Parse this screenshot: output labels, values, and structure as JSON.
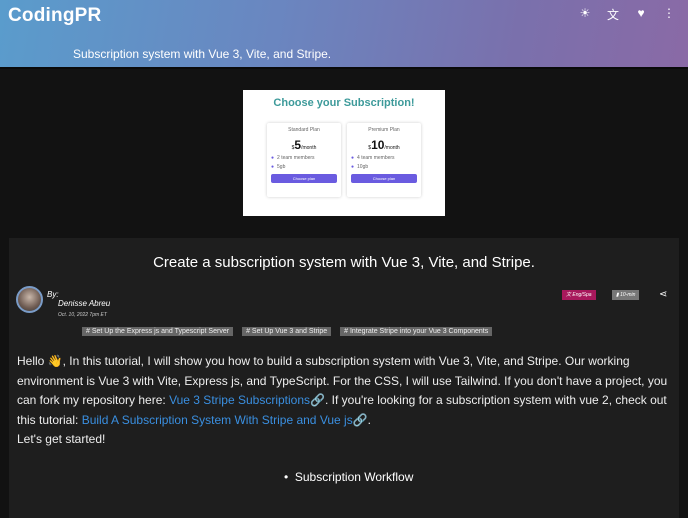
{
  "header": {
    "brand": "CodingPR",
    "subtitle": "Subscription system with Vue 3, Vite, and Stripe.",
    "icons": [
      "brightness-icon",
      "translate-icon",
      "heart-icon",
      "more-vert-icon"
    ]
  },
  "preview": {
    "title": "Choose your Subscription!",
    "plans": [
      {
        "name": "Standard Plan",
        "currency": "$",
        "price": "5",
        "period": "/month",
        "features": [
          "2 team members",
          "5gb"
        ],
        "button": "Choose plan"
      },
      {
        "name": "Premium Plan",
        "currency": "$",
        "price": "10",
        "period": "/month",
        "features": [
          "4 team members",
          "10gb"
        ],
        "button": "Choose plan"
      }
    ]
  },
  "article": {
    "title": "Create a subscription system with Vue 3, Vite, and Stripe.",
    "by": "By:",
    "author": "Denisse Abreu",
    "date": "Oct. 10, 2022 7pm ET",
    "language": "Eng/Spa",
    "read_time": "10-min",
    "tags": [
      "# Set Up the Express js and Typescript Server",
      "# Set Up Vue 3 and Stripe",
      "# Integrate Stripe into your Vue 3 Components"
    ],
    "intro": "Hello 👋, In this tutorial, I will show you how to build a subscription system with Vue 3, Vite, and Stripe. Our working environment is Vue 3 with Vite, Express js, and TypeScript. For the CSS, I will use Tailwind. If you don't have a project, you can fork my repository here: ",
    "link1": "Vue 3 Stripe Subscriptions🔗",
    "mid": ". If you're looking for a subscription system with vue 2, check out this tutorial: ",
    "link2": "Build A Subscription System With Stripe and Vue js🔗",
    "end": ".",
    "start": "Let's get started!",
    "list_item": "Subscription Workflow"
  }
}
